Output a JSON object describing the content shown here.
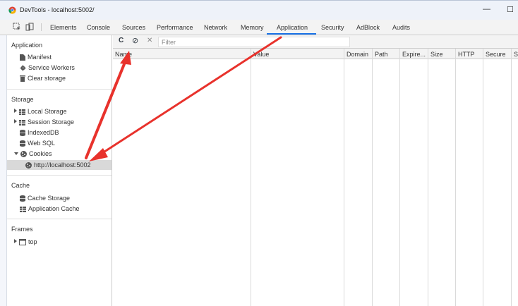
{
  "window": {
    "title": "DevTools - localhost:5002/",
    "minimize_glyph": "—",
    "maximize_glyph": "☐"
  },
  "tabs": [
    {
      "label": "Elements"
    },
    {
      "label": "Console"
    },
    {
      "label": "Sources"
    },
    {
      "label": "Performance"
    },
    {
      "label": "Network"
    },
    {
      "label": "Memory"
    },
    {
      "label": "Application"
    },
    {
      "label": "Security"
    },
    {
      "label": "AdBlock"
    },
    {
      "label": "Audits"
    }
  ],
  "active_tab": "Application",
  "sidebar": {
    "application": {
      "header": "Application",
      "items": [
        {
          "label": "Manifest",
          "icon": "file-icon"
        },
        {
          "label": "Service Workers",
          "icon": "gear-icon"
        },
        {
          "label": "Clear storage",
          "icon": "trash-icon"
        }
      ]
    },
    "storage": {
      "header": "Storage",
      "items": [
        {
          "label": "Local Storage",
          "icon": "grid-icon"
        },
        {
          "label": "Session Storage",
          "icon": "grid-icon"
        },
        {
          "label": "IndexedDB",
          "icon": "database-icon"
        },
        {
          "label": "Web SQL",
          "icon": "database-icon"
        },
        {
          "label": "Cookies",
          "icon": "cookie-icon"
        },
        {
          "label": "http://localhost:5002",
          "icon": "cookie-icon"
        }
      ]
    },
    "cache": {
      "header": "Cache",
      "items": [
        {
          "label": "Cache Storage",
          "icon": "database-icon"
        },
        {
          "label": "Application Cache",
          "icon": "grid-icon"
        }
      ]
    },
    "frames": {
      "header": "Frames",
      "items": [
        {
          "label": "top",
          "icon": "frame-icon"
        }
      ]
    }
  },
  "toolbar": {
    "filter_placeholder": "Filter",
    "refresh_glyph": "C",
    "clear_all_glyph": "⊘",
    "delete_glyph": "✕"
  },
  "table": {
    "columns": [
      "Name",
      "Value",
      "Domain",
      "Path",
      "Expire...",
      "Size",
      "HTTP",
      "Secure",
      "S"
    ]
  },
  "colors": {
    "active_tab_underline": "#1a73e8",
    "annotation_arrow": "#e8322c",
    "selected_row": "#d9d9d9"
  }
}
